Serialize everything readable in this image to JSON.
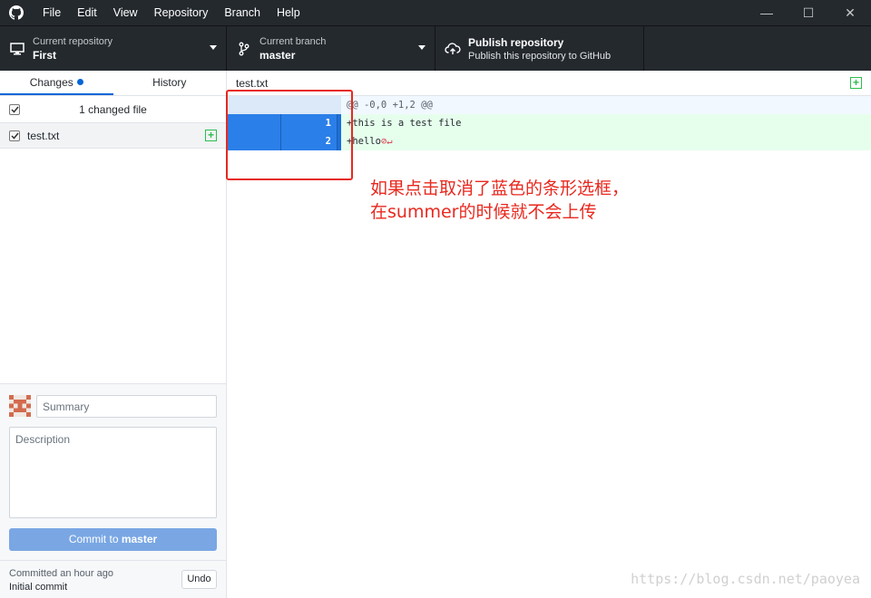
{
  "titlebar": {
    "menu": [
      "File",
      "Edit",
      "View",
      "Repository",
      "Branch",
      "Help"
    ],
    "controls": [
      "—",
      "☐",
      "✕"
    ]
  },
  "toolbar": {
    "repo": {
      "title": "Current repository",
      "value": "First"
    },
    "branch": {
      "title": "Current branch",
      "value": "master"
    },
    "publish": {
      "title": "Publish repository",
      "value": "Publish this repository to GitHub"
    }
  },
  "sidebar": {
    "tabs": [
      {
        "label": "Changes"
      },
      {
        "label": "History"
      }
    ],
    "changed_header": "1 changed file",
    "files": [
      {
        "name": "test.txt"
      }
    ]
  },
  "commit": {
    "summary_placeholder": "Summary",
    "description_placeholder": "Description",
    "button_prefix": "Commit to ",
    "button_branch": "master"
  },
  "last_commit": {
    "when": "Committed an hour ago",
    "message": "Initial commit",
    "undo_label": "Undo"
  },
  "diff": {
    "filename": "test.txt",
    "hunk": "@@ -0,0 +1,2 @@",
    "lines": [
      {
        "new_no": "1",
        "text": "+this is a test file",
        "nl": ""
      },
      {
        "new_no": "2",
        "text": "+hello",
        "nl": "⊘↵"
      }
    ]
  },
  "annotation": {
    "line1": "如果点击取消了蓝色的条形选框，",
    "line2": "在summer的时候就不会上传"
  },
  "watermark": "https://blog.csdn.net/paoyea",
  "colors": {
    "titlebar": "#24292e",
    "accent": "#0366d6",
    "selected_line": "#2b7fe9",
    "added_bg": "#e6ffed",
    "annotation": "#e8281e"
  }
}
